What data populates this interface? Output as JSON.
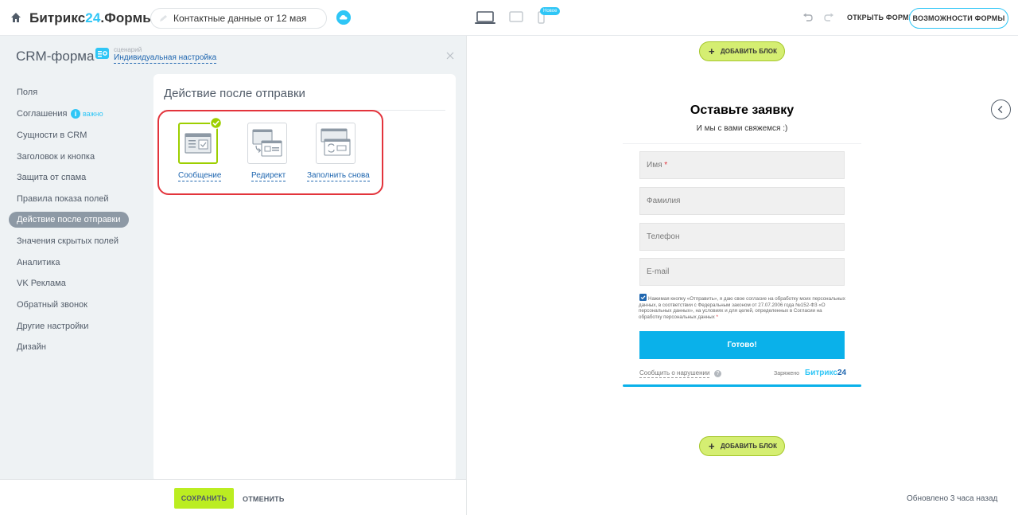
{
  "header": {
    "logo_main": "Битрикс",
    "logo_num": "24",
    "logo_suffix": ".Формы",
    "form_name": "Контактные данные от 12 мая",
    "new_badge": "Новое",
    "open_form": "ОТКРЫТЬ ФОРМУ",
    "features": "ВОЗМОЖНОСТИ ФОРМЫ"
  },
  "panel": {
    "title": "CRM-форма",
    "scenario_small": "сценарий",
    "scenario_link": "Индивидуальная настройка",
    "menu": [
      {
        "label": "Поля"
      },
      {
        "label": "Соглашения"
      },
      {
        "label": "Сущности в CRM"
      },
      {
        "label": "Заголовок и кнопка"
      },
      {
        "label": "Защита от спама"
      },
      {
        "label": "Правила показа полей"
      },
      {
        "label": "Действие после отправки"
      },
      {
        "label": "Значения скрытых полей"
      },
      {
        "label": "Аналитика"
      },
      {
        "label": "VK Реклама"
      },
      {
        "label": "Обратный звонок"
      },
      {
        "label": "Другие настройки"
      },
      {
        "label": "Дизайн"
      }
    ],
    "info_glyph": "i",
    "important": "важно",
    "content_title": "Действие после отправки",
    "options": [
      {
        "label": "Сообщение",
        "selected": true
      },
      {
        "label": "Редирект",
        "selected": false
      },
      {
        "label": "Заполнить снова",
        "selected": false
      }
    ],
    "save": "СОХРАНИТЬ",
    "cancel": "ОТМЕНИТЬ"
  },
  "preview": {
    "add_block": "ДОБАВИТЬ БЛОК",
    "add_block_plus": "+",
    "title": "Оставьте заявку",
    "subtitle": "И мы с вами свяжемся :)",
    "fields": [
      {
        "placeholder": "Имя",
        "required_mark": "*"
      },
      {
        "placeholder": "Фамилия",
        "required_mark": ""
      },
      {
        "placeholder": "Телефон",
        "required_mark": ""
      },
      {
        "placeholder": "E-mail",
        "required_mark": ""
      }
    ],
    "consent": "Нажимая кнопку «Отправить», я даю свое согласие на обработку моих персональных данных, в соответствии с Федеральным законом от 27.07.2006 года №152-ФЗ «О персональных данных», на условиях и для целей, определенных в Согласии на обработку персональных данных",
    "consent_req": "*",
    "submit": "Готово!",
    "report": "Сообщить о нарушении",
    "help_glyph": "?",
    "charged": "Заряжено",
    "b24_text": "Битрикс",
    "b24_num": "24",
    "updated": "Обновлено 3 часа назад"
  },
  "colors": {
    "accent": "#2fc6f6",
    "link": "#2067b0",
    "save": "#bbed21",
    "submit": "#0ab1ea",
    "highlight": "#e3343c",
    "selected": "#9dcf00"
  }
}
